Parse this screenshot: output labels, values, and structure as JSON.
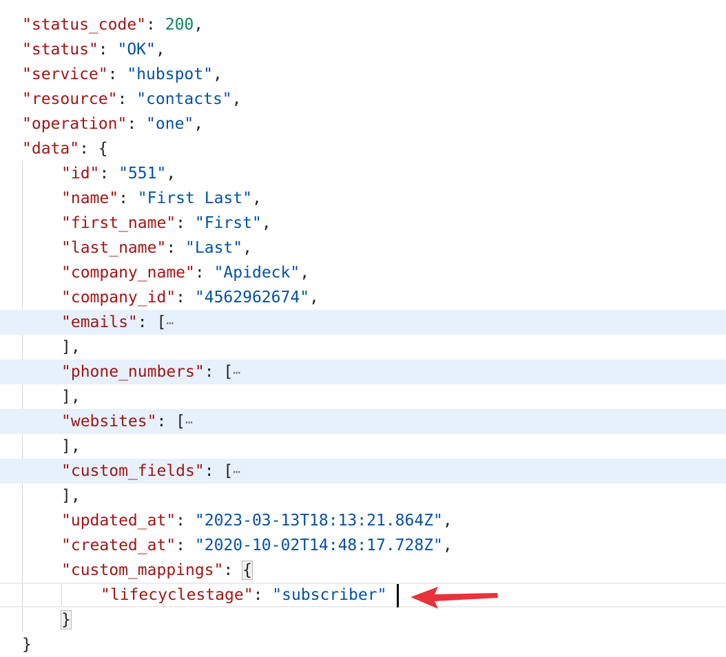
{
  "json_viewer": {
    "lines": [
      {
        "indent": 0,
        "tokens": [
          {
            "t": "key",
            "v": "\"status_code\""
          },
          {
            "t": "pun",
            "v": ": "
          },
          {
            "t": "num",
            "v": "200"
          },
          {
            "t": "pun",
            "v": ","
          }
        ]
      },
      {
        "indent": 0,
        "tokens": [
          {
            "t": "key",
            "v": "\"status\""
          },
          {
            "t": "pun",
            "v": ": "
          },
          {
            "t": "str",
            "v": "\"OK\""
          },
          {
            "t": "pun",
            "v": ","
          }
        ]
      },
      {
        "indent": 0,
        "tokens": [
          {
            "t": "key",
            "v": "\"service\""
          },
          {
            "t": "pun",
            "v": ": "
          },
          {
            "t": "str",
            "v": "\"hubspot\""
          },
          {
            "t": "pun",
            "v": ","
          }
        ]
      },
      {
        "indent": 0,
        "tokens": [
          {
            "t": "key",
            "v": "\"resource\""
          },
          {
            "t": "pun",
            "v": ": "
          },
          {
            "t": "str",
            "v": "\"contacts\""
          },
          {
            "t": "pun",
            "v": ","
          }
        ]
      },
      {
        "indent": 0,
        "tokens": [
          {
            "t": "key",
            "v": "\"operation\""
          },
          {
            "t": "pun",
            "v": ": "
          },
          {
            "t": "str",
            "v": "\"one\""
          },
          {
            "t": "pun",
            "v": ","
          }
        ]
      },
      {
        "indent": 0,
        "tokens": [
          {
            "t": "key",
            "v": "\"data\""
          },
          {
            "t": "pun",
            "v": ": {"
          }
        ]
      },
      {
        "indent": 1,
        "tokens": [
          {
            "t": "key",
            "v": "\"id\""
          },
          {
            "t": "pun",
            "v": ": "
          },
          {
            "t": "str",
            "v": "\"551\""
          },
          {
            "t": "pun",
            "v": ","
          }
        ]
      },
      {
        "indent": 1,
        "tokens": [
          {
            "t": "key",
            "v": "\"name\""
          },
          {
            "t": "pun",
            "v": ": "
          },
          {
            "t": "str",
            "v": "\"First Last\""
          },
          {
            "t": "pun",
            "v": ","
          }
        ]
      },
      {
        "indent": 1,
        "tokens": [
          {
            "t": "key",
            "v": "\"first_name\""
          },
          {
            "t": "pun",
            "v": ": "
          },
          {
            "t": "str",
            "v": "\"First\""
          },
          {
            "t": "pun",
            "v": ","
          }
        ]
      },
      {
        "indent": 1,
        "tokens": [
          {
            "t": "key",
            "v": "\"last_name\""
          },
          {
            "t": "pun",
            "v": ": "
          },
          {
            "t": "str",
            "v": "\"Last\""
          },
          {
            "t": "pun",
            "v": ","
          }
        ]
      },
      {
        "indent": 1,
        "tokens": [
          {
            "t": "key",
            "v": "\"company_name\""
          },
          {
            "t": "pun",
            "v": ": "
          },
          {
            "t": "str",
            "v": "\"Apideck\""
          },
          {
            "t": "pun",
            "v": ","
          }
        ]
      },
      {
        "indent": 1,
        "tokens": [
          {
            "t": "key",
            "v": "\"company_id\""
          },
          {
            "t": "pun",
            "v": ": "
          },
          {
            "t": "str",
            "v": "\"4562962674\""
          },
          {
            "t": "pun",
            "v": ","
          }
        ]
      },
      {
        "indent": 1,
        "folded": true,
        "tokens": [
          {
            "t": "key",
            "v": "\"emails\""
          },
          {
            "t": "pun",
            "v": ": ["
          },
          {
            "t": "ell",
            "v": "⋯"
          }
        ]
      },
      {
        "indent": 1,
        "tokens": [
          {
            "t": "pun",
            "v": "],"
          }
        ]
      },
      {
        "indent": 1,
        "folded": true,
        "tokens": [
          {
            "t": "key",
            "v": "\"phone_numbers\""
          },
          {
            "t": "pun",
            "v": ": ["
          },
          {
            "t": "ell",
            "v": "⋯"
          }
        ]
      },
      {
        "indent": 1,
        "tokens": [
          {
            "t": "pun",
            "v": "],"
          }
        ]
      },
      {
        "indent": 1,
        "folded": true,
        "tokens": [
          {
            "t": "key",
            "v": "\"websites\""
          },
          {
            "t": "pun",
            "v": ": ["
          },
          {
            "t": "ell",
            "v": "⋯"
          }
        ]
      },
      {
        "indent": 1,
        "tokens": [
          {
            "t": "pun",
            "v": "],"
          }
        ]
      },
      {
        "indent": 1,
        "folded": true,
        "tokens": [
          {
            "t": "key",
            "v": "\"custom_fields\""
          },
          {
            "t": "pun",
            "v": ": ["
          },
          {
            "t": "ell",
            "v": "⋯"
          }
        ]
      },
      {
        "indent": 1,
        "tokens": [
          {
            "t": "pun",
            "v": "],"
          }
        ]
      },
      {
        "indent": 1,
        "tokens": [
          {
            "t": "key",
            "v": "\"updated_at\""
          },
          {
            "t": "pun",
            "v": ": "
          },
          {
            "t": "str",
            "v": "\"2023-03-13T18:13:21.864Z\""
          },
          {
            "t": "pun",
            "v": ","
          }
        ]
      },
      {
        "indent": 1,
        "tokens": [
          {
            "t": "key",
            "v": "\"created_at\""
          },
          {
            "t": "pun",
            "v": ": "
          },
          {
            "t": "str",
            "v": "\"2020-10-02T14:48:17.728Z\""
          },
          {
            "t": "pun",
            "v": ","
          }
        ]
      },
      {
        "indent": 1,
        "tokens": [
          {
            "t": "key",
            "v": "\"custom_mappings\""
          },
          {
            "t": "pun",
            "v": ": "
          },
          {
            "t": "brk",
            "v": "{"
          }
        ]
      },
      {
        "indent": 2,
        "current": true,
        "tokens": [
          {
            "t": "key",
            "v": "\"lifecyclestage\""
          },
          {
            "t": "pun",
            "v": ": "
          },
          {
            "t": "str",
            "v": "\"subscriber\""
          }
        ]
      },
      {
        "indent": 1,
        "tokens": [
          {
            "t": "brk",
            "v": "}"
          }
        ]
      },
      {
        "indent": 0,
        "tokens": [
          {
            "t": "pun",
            "v": "}"
          }
        ]
      }
    ],
    "colors": {
      "key": "#a31515",
      "string": "#0451a5",
      "number": "#098658",
      "fold_highlight": "#e7f1fc",
      "annotation_arrow": "#e8323c"
    },
    "icons": {
      "ellipsis": "fold-ellipsis-icon",
      "arrow": "red-arrow-icon"
    }
  }
}
